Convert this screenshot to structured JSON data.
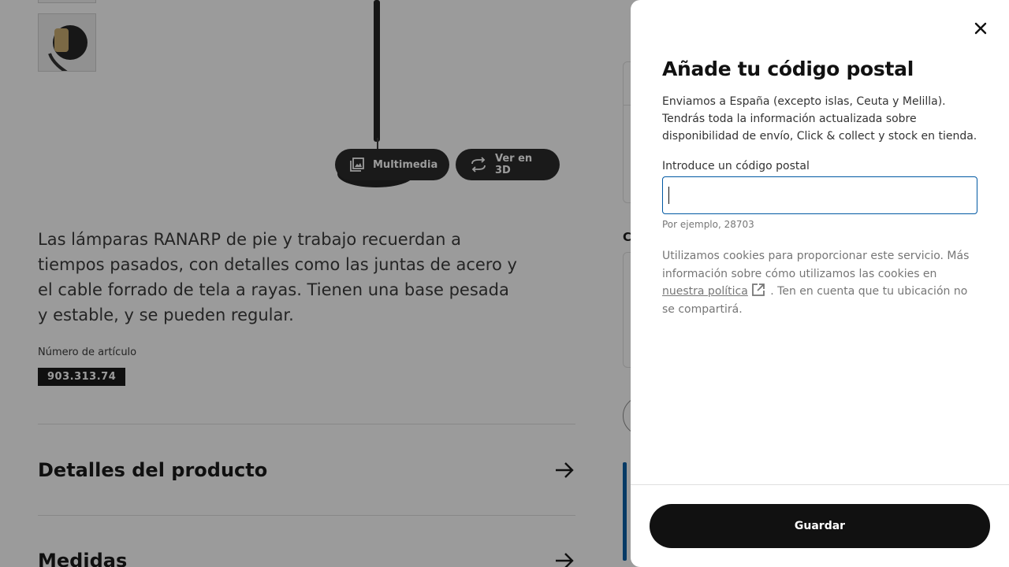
{
  "background": {
    "media_buttons": {
      "multimedia_label": "Multimedia",
      "view3d_label": "Ver en 3D"
    },
    "description": "Las lámparas RANARP de pie y trabajo recuerdan a tiempos pasados, con detalles como las juntas de acero y el cable forrado de tela a rayas. Tienen una base pesada y estable, y se pueden regular.",
    "article_label": "Número de artículo",
    "article_number": "903.313.74",
    "sections": {
      "details": "Detalles del producto",
      "measures": "Medidas"
    },
    "right_column_letter": "C"
  },
  "modal": {
    "title": "Añade tu código postal",
    "description": "Enviamos a España (excepto islas, Ceuta y Melilla). Tendrás toda la información actualizada sobre disponibilidad de envío, Click & collect y stock en tienda.",
    "field_label": "Introduce un código postal",
    "field_value": "",
    "field_hint": "Por ejemplo, 28703",
    "cookie_text_before": "Utilizamos cookies para proporcionar este servicio. Más información sobre cómo utilizamos las cookies en ",
    "cookie_link": "nuestra política",
    "cookie_text_after": " . Ten en cuenta que tu ubicación no se compartirá.",
    "save_label": "Guardar"
  },
  "icons": {
    "close": "close-icon",
    "multimedia": "image-gallery-icon",
    "view3d": "rotate-3d-icon",
    "arrow": "arrow-right-icon",
    "external_link": "external-link-icon"
  },
  "colors": {
    "overlay": "#111111",
    "accent_blue": "#0058a3",
    "button_dark": "#111111",
    "muted_text": "#767676"
  }
}
